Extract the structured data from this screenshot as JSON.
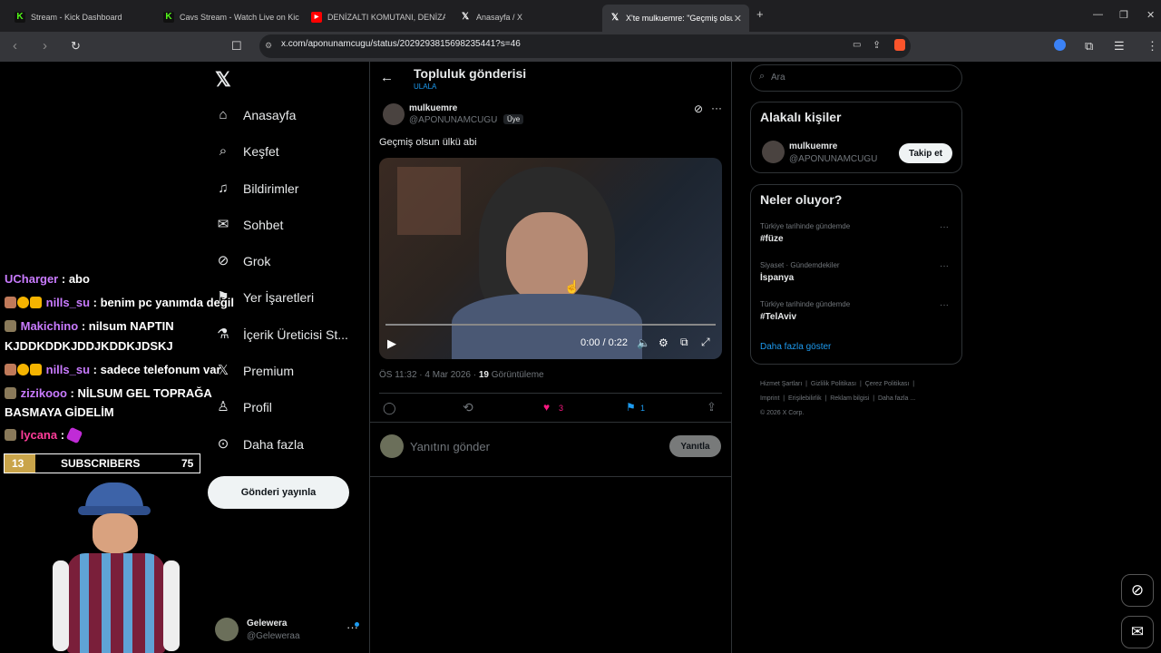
{
  "browser": {
    "tabs": [
      {
        "title": "Stream - Kick Dashboard",
        "icon": "kick-icon"
      },
      {
        "title": "Cavs Stream - Watch Live on Kick",
        "icon": "kick-icon"
      },
      {
        "title": "DENİZALTI KOMUTANI, DENİZALTI SA",
        "icon": "youtube-icon"
      },
      {
        "title": "Anasayfa / X",
        "icon": "x-icon"
      },
      {
        "title": "X'te mulkuemre: \"Geçmiş olsu",
        "icon": "x-icon",
        "active": true
      }
    ],
    "url": "x.com/aponunamcugu/status/2029293815698235441?s=46"
  },
  "x_nav": {
    "items": [
      {
        "label": "Anasayfa",
        "icon": "home-icon"
      },
      {
        "label": "Keşfet",
        "icon": "search-icon"
      },
      {
        "label": "Bildirimler",
        "icon": "bell-icon"
      },
      {
        "label": "Sohbet",
        "icon": "mail-icon"
      },
      {
        "label": "Grok",
        "icon": "grok-icon"
      },
      {
        "label": "Yer İşaretleri",
        "icon": "bookmark-icon"
      },
      {
        "label": "İçerik Üreticisi St...",
        "icon": "flask-icon"
      },
      {
        "label": "Premium",
        "icon": "x-icon"
      },
      {
        "label": "Profil",
        "icon": "person-icon"
      },
      {
        "label": "Daha fazla",
        "icon": "more-circle-icon"
      }
    ],
    "post_button": "Gönderi yayınla",
    "account": {
      "name": "Gelewera",
      "handle": "@Geleweraa"
    }
  },
  "stream_overlay": {
    "chat": [
      {
        "user": "UCharger",
        "message": ": abo"
      },
      {
        "user": "nills_su",
        "message": ": benim pc yanımda değil"
      },
      {
        "user": "Makichino",
        "message": ": nilsum NAPTIN"
      },
      {
        "user": "",
        "message": "KJDDKDDKJDDJKDDKJDSKJ"
      },
      {
        "user": "nills_su",
        "message": ": sadece telefonum var"
      },
      {
        "user": "zizikooo",
        "message": ": NİLSUM GEL TOPRAĞA"
      },
      {
        "user": "",
        "message": "BASMAYA GİDELİM"
      },
      {
        "user": "lycana",
        "message": ":"
      }
    ],
    "subs": {
      "left": "13",
      "label": "SUBSCRIBERS",
      "right": "75"
    }
  },
  "post": {
    "header_title": "Topluluk gönderisi",
    "header_sub": "ULALA",
    "author_name": "mulkuemre",
    "author_handle": "@APONUNAMCUGU",
    "member_badge": "Üye",
    "text": "Geçmiş olsun ülkü abi",
    "video_time": "0:00 / 0:22",
    "timestamp": "ÖS 11:32 · 4 Mar 2026 · ",
    "views_count": "19",
    "views_label": "Görüntüleme",
    "likes": "3",
    "bookmarks": "1",
    "reply_placeholder": "Yanıtını gönder",
    "reply_button": "Yanıtla"
  },
  "sidebar": {
    "search_placeholder": "Ara",
    "related_title": "Alakalı kişiler",
    "related_name": "mulkuemre",
    "related_handle": "@APONUNAMCUGU",
    "follow_label": "Takip et",
    "trends_title": "Neler oluyor?",
    "trends": [
      {
        "context": "Türkiye tarihinde gündemde",
        "name": "#füze"
      },
      {
        "context": "Siyaset · Gündemdekiler",
        "name": "İspanya"
      },
      {
        "context": "Türkiye tarihinde gündemde",
        "name": "#TelAviv"
      }
    ],
    "show_more": "Daha fazla göster",
    "footer": [
      "Hizmet Şartları",
      "Gizlilik Politikası",
      "Çerez Politikası",
      "Imprint",
      "Erişilebilirlik",
      "Reklam bilgisi",
      "Daha fazla ..."
    ],
    "copyright": "© 2026 X Corp."
  },
  "colors": {
    "accent": "#1d9bf0",
    "like": "#f91880",
    "chat_user": "#c97bff"
  }
}
